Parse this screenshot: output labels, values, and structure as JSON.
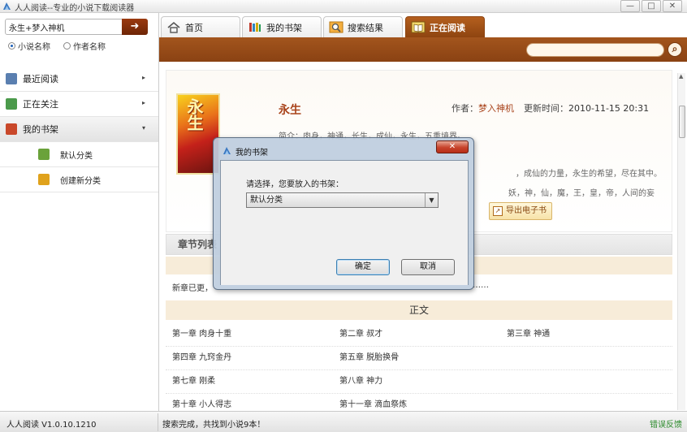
{
  "window": {
    "title": "人人阅读--专业的小说下载阅读器",
    "controls": [
      "—",
      "□",
      "✕"
    ]
  },
  "search": {
    "value": "永生+梦入神机",
    "go_icon": "arrow-right-icon",
    "options": [
      {
        "label": "小说名称",
        "selected": true
      },
      {
        "label": "作者名称",
        "selected": false
      }
    ]
  },
  "sidebar": {
    "items": [
      {
        "label": "最近阅读",
        "icon": "recent-icon",
        "color": "#5a7fb0",
        "arrow": "▸"
      },
      {
        "label": "正在关注",
        "icon": "follow-icon",
        "color": "#4b9a4b",
        "arrow": "▸"
      },
      {
        "label": "我的书架",
        "icon": "shelf-icon",
        "color": "#c9482a",
        "arrow": "▾",
        "active": true
      },
      {
        "label": "默认分类",
        "icon": "books-icon",
        "color": "#6aa23a",
        "sub": true
      },
      {
        "label": "创建新分类",
        "icon": "new-category-icon",
        "color": "#e0a21c",
        "sub": true
      }
    ]
  },
  "tabs": [
    {
      "label": "首页",
      "icon": "home-icon"
    },
    {
      "label": "我的书架",
      "icon": "bookshelf-icon"
    },
    {
      "label": "搜索结果",
      "icon": "search-results-icon"
    },
    {
      "label": "正在阅读",
      "icon": "reading-icon",
      "active": true
    }
  ],
  "book": {
    "cover_text": "永生",
    "title": "永生",
    "author_label": "作者：",
    "author": "梦入神机",
    "updated_label": "更新时间：",
    "updated": "2010-11-15 20:31",
    "intro": "简介：肉身，神通，长生，成仙，永生，五重境界。",
    "intro_tail1": "，成仙的力量，永生的希望，尽在其中。",
    "intro_tail2": "妖，神，仙，魔，王，皇，帝，人间的妄",
    "export_label": "导出电子书"
  },
  "chapters_section": {
    "heading": "章节列表",
    "newest_prefix": "新章已更，",
    "newest_tail": "……",
    "body_heading": "正文",
    "rows": [
      [
        "第一章 肉身十重",
        "第二章 叔才",
        "第三章 神通"
      ],
      [
        "第四章 九窍金丹",
        "第五章 脱胎换骨",
        ""
      ],
      [
        "第七章 刚柔",
        "第八章 神力",
        ""
      ],
      [
        "第十章 小人得志",
        "第十一章 滴血祭炼",
        ""
      ]
    ]
  },
  "dialog": {
    "title": "我的书架",
    "close_label": "✕",
    "prompt": "请选择，您要放入的书架：",
    "selected": "默认分类",
    "ok_label": "确定",
    "cancel_label": "取消"
  },
  "status": {
    "version": "人人阅读 V1.0.10.1210",
    "message": "搜索完成，共找到小说9本！",
    "feedback": "错误反馈"
  }
}
